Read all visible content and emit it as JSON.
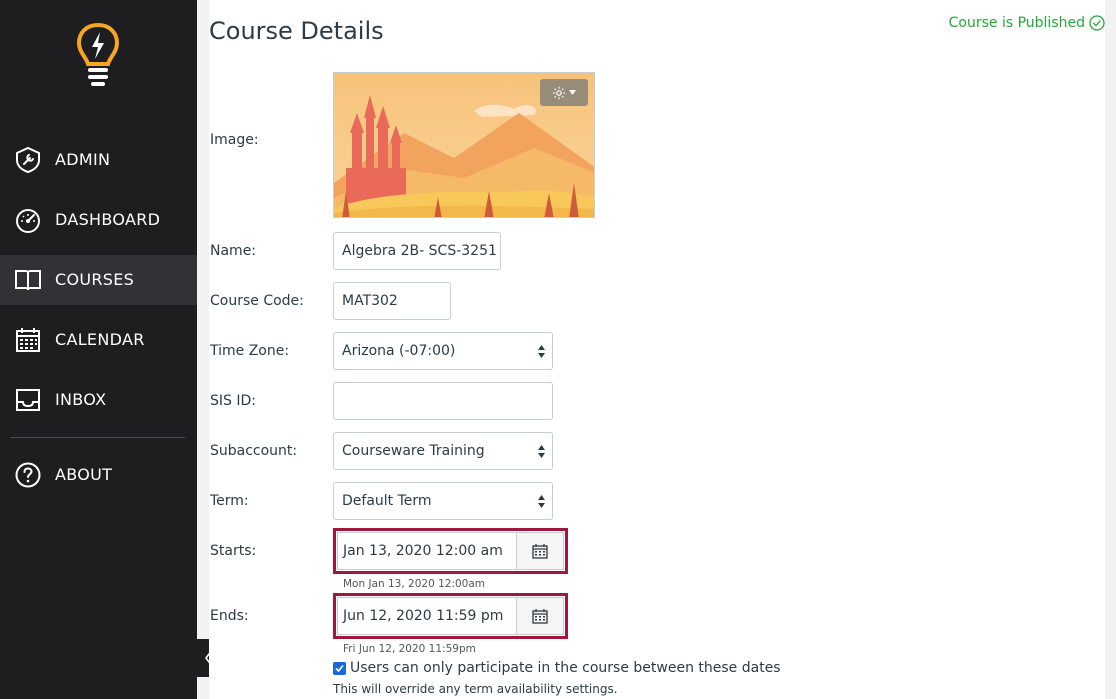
{
  "sidebar": {
    "items": [
      {
        "label": "ADMIN",
        "icon": "shield-wrench-icon"
      },
      {
        "label": "DASHBOARD",
        "icon": "speedometer-icon"
      },
      {
        "label": "COURSES",
        "icon": "open-book-icon",
        "active": true
      },
      {
        "label": "CALENDAR",
        "icon": "calendar-icon"
      },
      {
        "label": "INBOX",
        "icon": "inbox-icon"
      },
      {
        "label": "ABOUT",
        "icon": "question-circle-icon"
      }
    ]
  },
  "main": {
    "title": "Course Details",
    "status": "Course is Published",
    "labels": {
      "image": "Image:",
      "name": "Name:",
      "course_code": "Course Code:",
      "time_zone": "Time Zone:",
      "sis_id": "SIS ID:",
      "subaccount": "Subaccount:",
      "term": "Term:",
      "starts": "Starts:",
      "ends": "Ends:"
    },
    "fields": {
      "name": "Algebra 2B- SCS-3251",
      "course_code": "MAT302",
      "time_zone": "Arizona (-07:00)",
      "sis_id": "",
      "subaccount": "Courseware Training",
      "term": "Default Term",
      "starts": "Jan 13, 2020 12:00 am",
      "starts_hint": "Mon Jan 13, 2020 12:00am",
      "ends": "Jun 12, 2020 11:59 pm",
      "ends_hint": "Fri Jun 12, 2020 11:59pm"
    },
    "participation_checkbox": {
      "label": "Users can only participate in the course between these dates",
      "checked": true,
      "note": "This will override any term availability settings."
    }
  },
  "colors": {
    "sidebar_bg": "#1e1e21",
    "sidebar_active": "#313136",
    "published_green": "#23a836",
    "date_highlight": "#a0173b",
    "logo_orange": "#f6a623"
  }
}
